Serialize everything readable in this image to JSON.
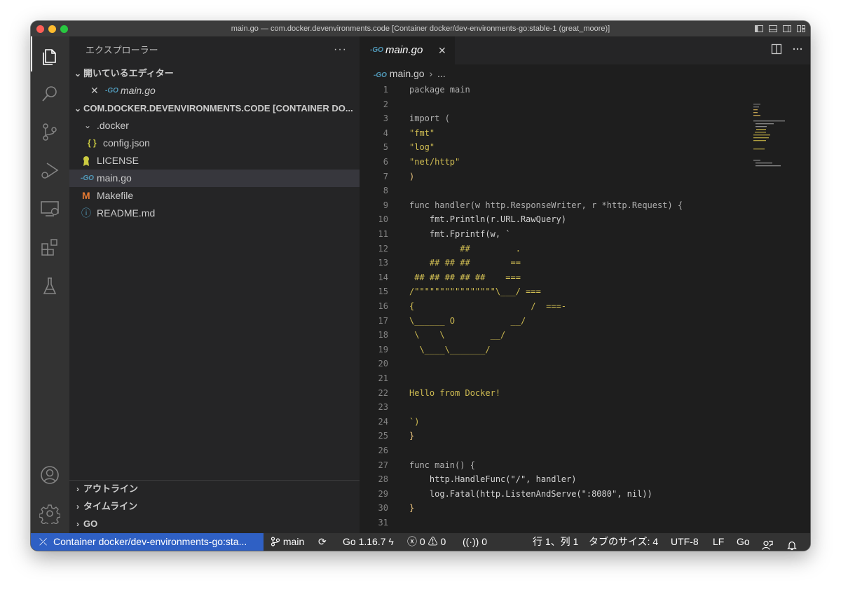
{
  "window": {
    "title": "main.go — com.docker.devenvironments.code [Container docker/dev-environments-go:stable-1 (great_moore)]"
  },
  "activity_bar": {
    "items": [
      "explorer-icon",
      "search-icon",
      "source-control-icon",
      "run-debug-icon",
      "remote-explorer-icon",
      "extensions-icon",
      "testing-icon"
    ],
    "bottom": [
      "account-icon",
      "settings-gear-icon"
    ]
  },
  "sidebar": {
    "title": "エクスプローラー",
    "more": "···",
    "open_editors": {
      "header": "開いているエディター",
      "items": [
        {
          "icon": "-GO",
          "label": "main.go"
        }
      ]
    },
    "workspace": {
      "header": "COM.DOCKER.DEVENVIRONMENTS.CODE [CONTAINER DO...",
      "items": [
        {
          "icon": "",
          "label": ".docker"
        },
        {
          "icon": "{ }",
          "label": "config.json"
        },
        {
          "icon": "ribbon-icon",
          "label": "LICENSE"
        },
        {
          "icon": "-GO",
          "label": "main.go"
        },
        {
          "icon": "M",
          "label": "Makefile"
        },
        {
          "icon": "ⓘ",
          "label": "README.md"
        }
      ]
    },
    "bottom_sections": [
      "アウトライン",
      "タイムライン",
      "GO"
    ]
  },
  "editor": {
    "tab": {
      "icon": "-GO",
      "label": "main.go",
      "close": "✕"
    },
    "breadcrumb": {
      "file": "main.go",
      "sep": "›",
      "rest": "..."
    },
    "lines": [
      "package main",
      "",
      "import (",
      "\"fmt\"",
      "\"log\"",
      "\"net/http\"",
      ")",
      "",
      "func handler(w http.ResponseWriter, r *http.Request) {",
      "    fmt.Println(r.URL.RawQuery)",
      "    fmt.Fprintf(w, `",
      "          ##         .",
      "    ## ## ##        ==",
      " ## ## ## ## ##    ===",
      "/\"\"\"\"\"\"\"\"\"\"\"\"\"\"\"\"\\___/ ===",
      "{                       /  ===-",
      "\\______ O           __/",
      " \\    \\         __/",
      "  \\____\\_______/",
      "",
      "",
      "Hello from Docker!",
      "",
      "`)",
      "}",
      "",
      "func main() {",
      "    http.HandleFunc(\"/\", handler)",
      "    log.Fatal(http.ListenAndServe(\":8080\", nil))",
      "}",
      ""
    ]
  },
  "statusbar": {
    "remote": "Container docker/dev-environments-go:sta...",
    "branch": "main",
    "go_version": "Go 1.16.7",
    "errors": "0",
    "warnings": "0",
    "ports": "0",
    "position": "行 1、列 1",
    "tab_size": "タブのサイズ: 4",
    "encoding": "UTF-8",
    "eol": "LF",
    "language": "Go"
  },
  "colors": {
    "accent": "#2f60c4",
    "activitybar": "#333333",
    "sidebar": "#252526",
    "editor": "#1e1e1e"
  }
}
